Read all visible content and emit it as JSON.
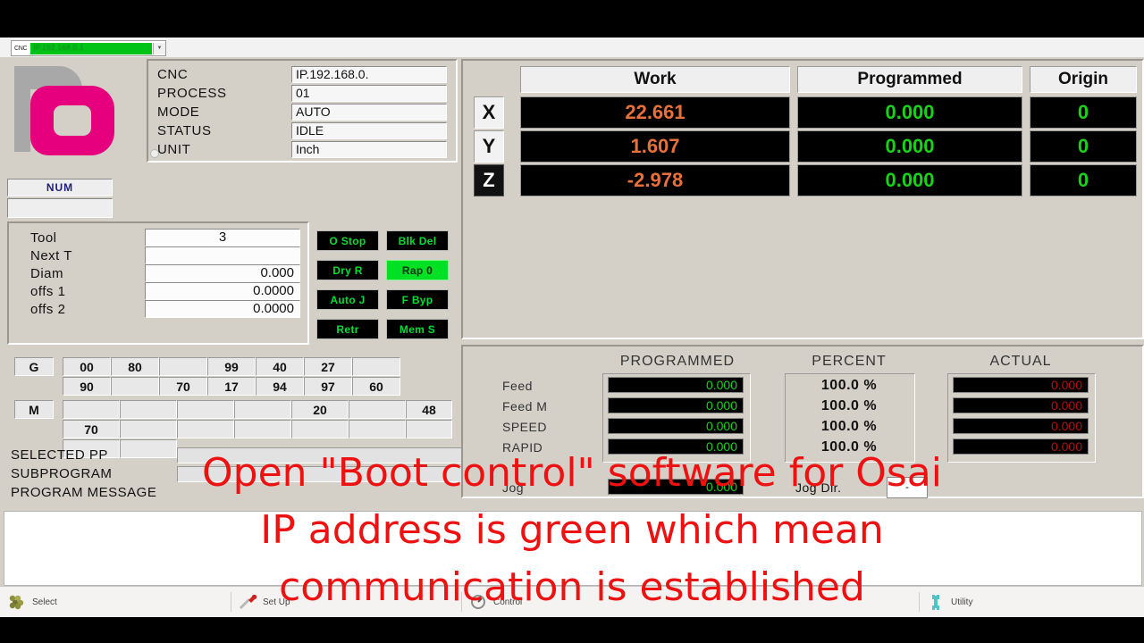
{
  "topbar": {
    "cnc_tag": "CNC",
    "cnc_selected": "IP.192.168.0.1",
    "dropdown_arrow": "chevron-down-icon"
  },
  "logo": {
    "brand": "NUM"
  },
  "cnc_info": {
    "rows": [
      {
        "label": "CNC",
        "value": "IP.192.168.0."
      },
      {
        "label": "PROCESS",
        "value": "01"
      },
      {
        "label": "MODE",
        "value": "AUTO"
      },
      {
        "label": "STATUS",
        "value": "IDLE"
      },
      {
        "label": "UNIT",
        "value": "Inch"
      }
    ]
  },
  "tool": {
    "rows": [
      {
        "label": "Tool",
        "value": "3"
      },
      {
        "label": "Next T",
        "value": ""
      },
      {
        "label": "Diam",
        "value": "0.000"
      },
      {
        "label": "offs 1",
        "value": "0.0000"
      },
      {
        "label": "offs 2",
        "value": "0.0000"
      }
    ]
  },
  "status_buttons": [
    {
      "label": "O Stop",
      "active": false
    },
    {
      "label": "Blk Del",
      "active": false
    },
    {
      "label": "Dry R",
      "active": false
    },
    {
      "label": "Rap 0",
      "active": true
    },
    {
      "label": "Auto J",
      "active": false
    },
    {
      "label": "F Byp",
      "active": false
    },
    {
      "label": "Retr",
      "active": false
    },
    {
      "label": "Mem S",
      "active": false
    }
  ],
  "gm_table": {
    "g_key": "G",
    "m_key": "M",
    "g_row1": [
      "00",
      "80",
      "",
      "99",
      "40",
      "27",
      ""
    ],
    "g_row2": [
      "90",
      "",
      "70",
      "17",
      "94",
      "97",
      "60"
    ],
    "m_row1": [
      "",
      "",
      "",
      "",
      "20",
      "",
      "48"
    ],
    "m_row2": [
      "70",
      "",
      "",
      "",
      "",
      "",
      ""
    ],
    "m_row3": [
      "",
      ""
    ]
  },
  "program": {
    "rows": [
      {
        "label": "SELECTED PP",
        "value": ""
      },
      {
        "label": "SUBPROGRAM",
        "value": ""
      }
    ],
    "message_label": "PROGRAM MESSAGE",
    "message_value": ""
  },
  "positions": {
    "headers": [
      "Work",
      "Programmed",
      "Origin"
    ],
    "axes": [
      {
        "name": "X",
        "work": "22.661",
        "programmed": "0.000",
        "origin": "0",
        "inverted": false
      },
      {
        "name": "Y",
        "work": "1.607",
        "programmed": "0.000",
        "origin": "0",
        "inverted": false
      },
      {
        "name": "Z",
        "work": "-2.978",
        "programmed": "0.000",
        "origin": "0",
        "inverted": true
      }
    ],
    "colors": {
      "work": "#e8703a",
      "programmed": "#19d219",
      "origin": "#19d219"
    }
  },
  "feeds": {
    "headers": [
      "PROGRAMMED",
      "PERCENT",
      "ACTUAL"
    ],
    "rows": [
      {
        "label": "Feed",
        "programmed": "0.000",
        "percent": "100.0 %",
        "actual": "0.000"
      },
      {
        "label": "Feed   M",
        "programmed": "0.000",
        "percent": "100.0 %",
        "actual": "0.000"
      },
      {
        "label": "SPEED",
        "programmed": "0.000",
        "percent": "100.0 %",
        "actual": "0.000"
      },
      {
        "label": "RAPID",
        "programmed": "0.000",
        "percent": "100.0 %",
        "actual": "0.000"
      }
    ],
    "jog_label": "Jog",
    "jog_value": "0.000",
    "jog_dir_label": "Jog Dir.",
    "jog_dir_value": "-"
  },
  "statusbar": {
    "items": [
      {
        "label": "Select",
        "icon": "grapes-icon"
      },
      {
        "label": "Set Up",
        "icon": "screwdriver-icon"
      },
      {
        "label": "Control",
        "icon": "gauge-icon"
      },
      {
        "label": "Utility",
        "icon": "wrench-icon"
      }
    ]
  },
  "caption": {
    "line1": "Open \"Boot control\" software for Osai",
    "line2": "IP address is green which mean",
    "line3": "communication is established",
    "color": "#ee1111"
  }
}
